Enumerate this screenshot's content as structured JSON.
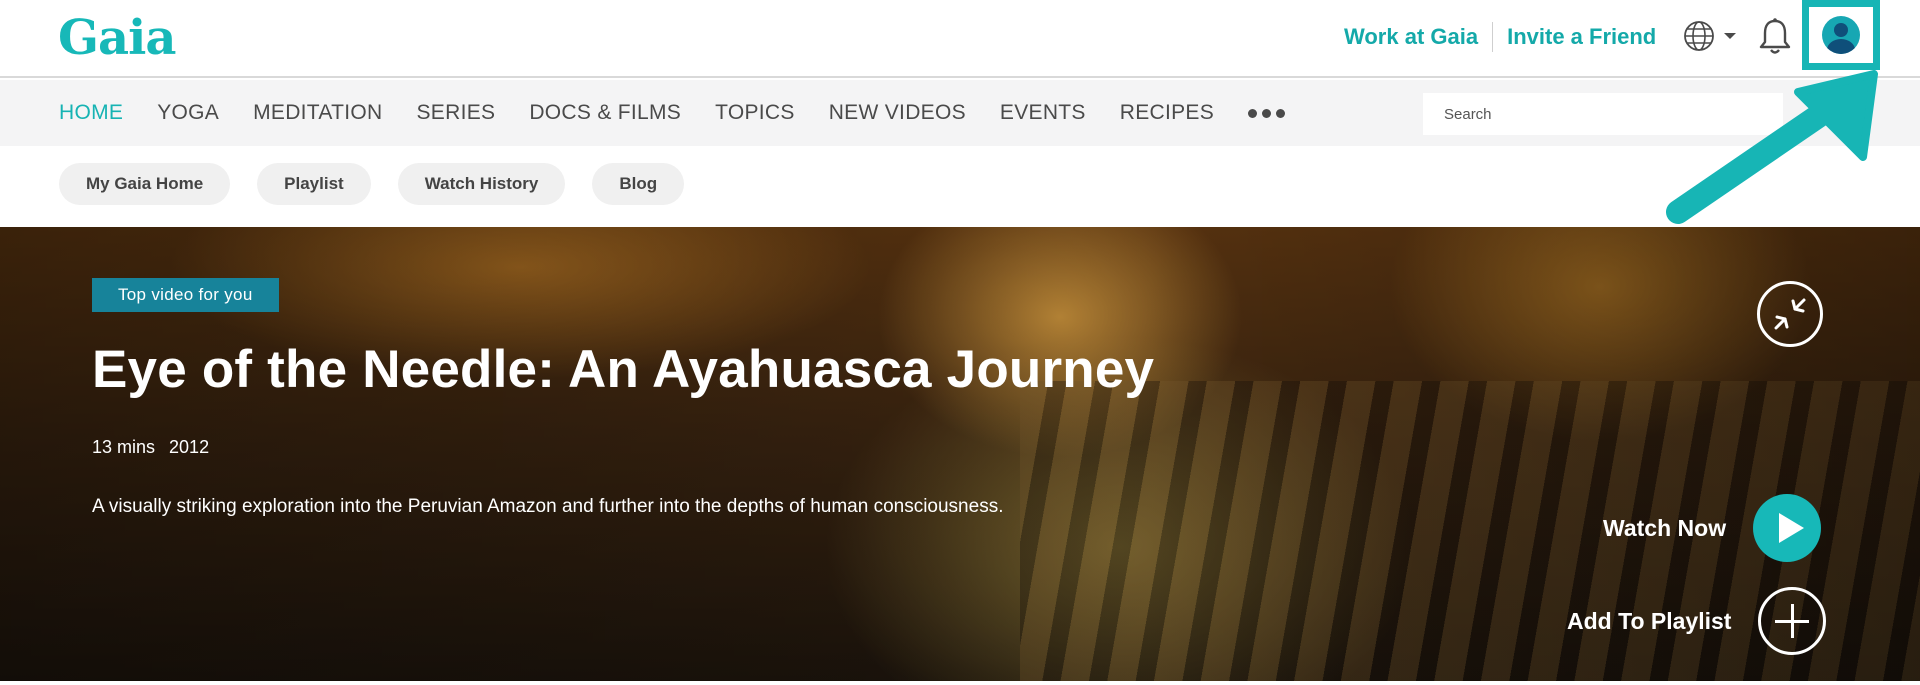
{
  "brand": {
    "logo_text": "Gaia",
    "accent_color": "#17b8b8"
  },
  "header": {
    "links": [
      {
        "label": "Work at Gaia"
      },
      {
        "label": "Invite a Friend"
      }
    ],
    "icons": [
      "globe-icon",
      "caret-down-icon",
      "bell-icon",
      "user-avatar-icon"
    ]
  },
  "nav": {
    "items": [
      {
        "label": "HOME",
        "active": true
      },
      {
        "label": "YOGA"
      },
      {
        "label": "MEDITATION"
      },
      {
        "label": "SERIES"
      },
      {
        "label": "DOCS & FILMS"
      },
      {
        "label": "TOPICS"
      },
      {
        "label": "NEW VIDEOS"
      },
      {
        "label": "EVENTS"
      },
      {
        "label": "RECIPES"
      }
    ],
    "more_icon": "more-dots-icon",
    "search": {
      "placeholder": "Search",
      "value": ""
    }
  },
  "subnav": {
    "pills": [
      {
        "label": "My Gaia Home"
      },
      {
        "label": "Playlist"
      },
      {
        "label": "Watch History"
      },
      {
        "label": "Blog"
      }
    ]
  },
  "hero": {
    "tag": "Top video for you",
    "title": "Eye of the Needle: An Ayahuasca Journey",
    "duration": "13 mins",
    "year": "2012",
    "description": "A visually striking exploration into the Peruvian Amazon and further into the depths of human consciousness.",
    "collapse_icon": "collapse-arrows-icon",
    "watch_label": "Watch Now",
    "playlist_label": "Add To Playlist"
  },
  "annotation": {
    "color": "#17b5b5",
    "target": "user-avatar"
  }
}
